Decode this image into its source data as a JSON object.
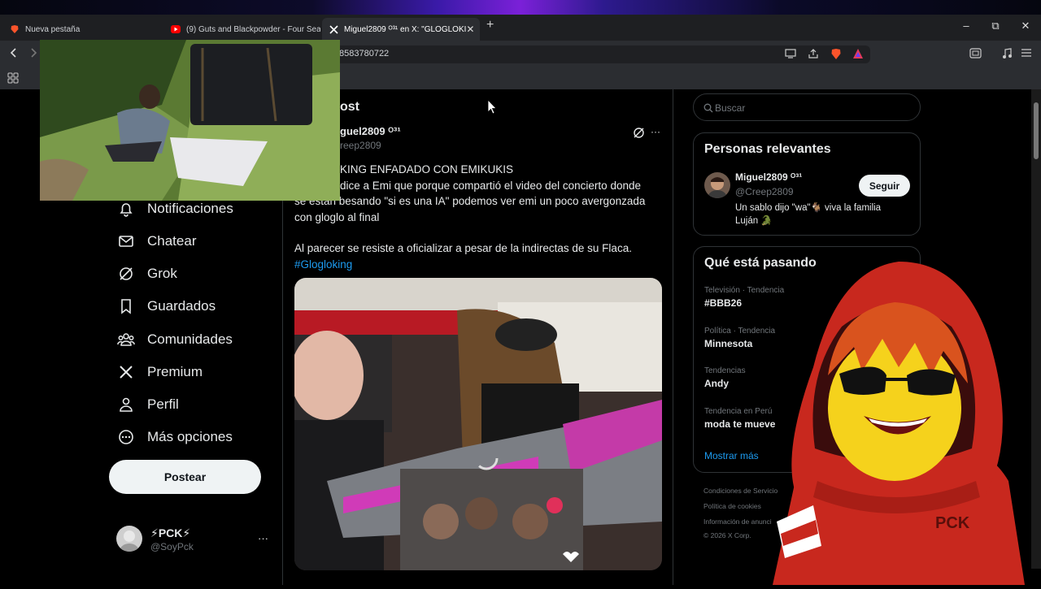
{
  "browser": {
    "tabs": [
      {
        "title": "Nueva pestaña",
        "icon": "brave-icon",
        "active": false
      },
      {
        "title": "(9) Guts and Blackpowder - Four Sea",
        "icon": "youtube-icon",
        "active": false
      },
      {
        "title": "Miguel2809 ᴼ³¹ en X: \"GLOGLOKI",
        "icon": "x-logo-icon",
        "active": true
      }
    ],
    "new_tab_label": "+",
    "url_tail": "8583780722",
    "window_controls": {
      "minimize": "–",
      "restore": "⧉",
      "close": "✕"
    }
  },
  "sidebar": {
    "nav": [
      {
        "label": "Notificaciones",
        "icon": "bell-icon"
      },
      {
        "label": "Chatear",
        "icon": "mail-icon"
      },
      {
        "label": "Grok",
        "icon": "grok-icon"
      },
      {
        "label": "Guardados",
        "icon": "bookmark-icon"
      },
      {
        "label": "Comunidades",
        "icon": "communities-icon"
      },
      {
        "label": "Premium",
        "icon": "x-logo-icon"
      },
      {
        "label": "Perfil",
        "icon": "person-icon"
      },
      {
        "label": "Más opciones",
        "icon": "more-circle-icon"
      }
    ],
    "post_button": "Postear",
    "account": {
      "name": "⚡PCK⚡",
      "handle": "@SoyPck",
      "more": "···"
    }
  },
  "post": {
    "header_title": "ost",
    "author_name": "guel2809 ᴼ³¹",
    "author_handle": "reep2809",
    "text_lines": [
      "KING ENFADADO CON EMIKUKIS",
      "dice a Emi que porque compartió el video del concierto donde",
      "se estan besando \"si es una IA\"  podemos ver emi un poco avergonzada",
      "con gloglo al final",
      "",
      "Al parecer  se resiste a oficializar a pesar de la indirectas de su Flaca."
    ],
    "hashtag": "#Glogloking"
  },
  "right_column": {
    "search_placeholder": "Buscar",
    "relevant": {
      "title": "Personas relevantes",
      "name": "Miguel2809 ᴼ³¹",
      "handle": "@Creep2809",
      "bio": "Un sablo dijo \"wa\"🐐 viva la familia Luján 🐊",
      "follow_label": "Seguir"
    },
    "trending": {
      "title": "Qué está pasando",
      "items": [
        {
          "category": "Televisión · Tendencia",
          "name": "#BBB26"
        },
        {
          "category": "Política · Tendencia",
          "name": "Minnesota"
        },
        {
          "category": "Tendencias",
          "name": "Andy"
        },
        {
          "category": "Tendencia en Perú",
          "name": "moda te mueve"
        }
      ],
      "show_more": "Mostrar más"
    },
    "footer": {
      "terms": "Condiciones de Servicio",
      "cookies": "Política de cookies",
      "ads": "Información de anunci",
      "copyright": "© 2026 X Corp."
    }
  },
  "overlay": {
    "hoodie_text": "PCK"
  },
  "colors": {
    "accent": "#1d9bf0",
    "background": "#000000",
    "hoodie": "#c8281e",
    "hair": "#d9531e",
    "face": "#f5d21c"
  }
}
